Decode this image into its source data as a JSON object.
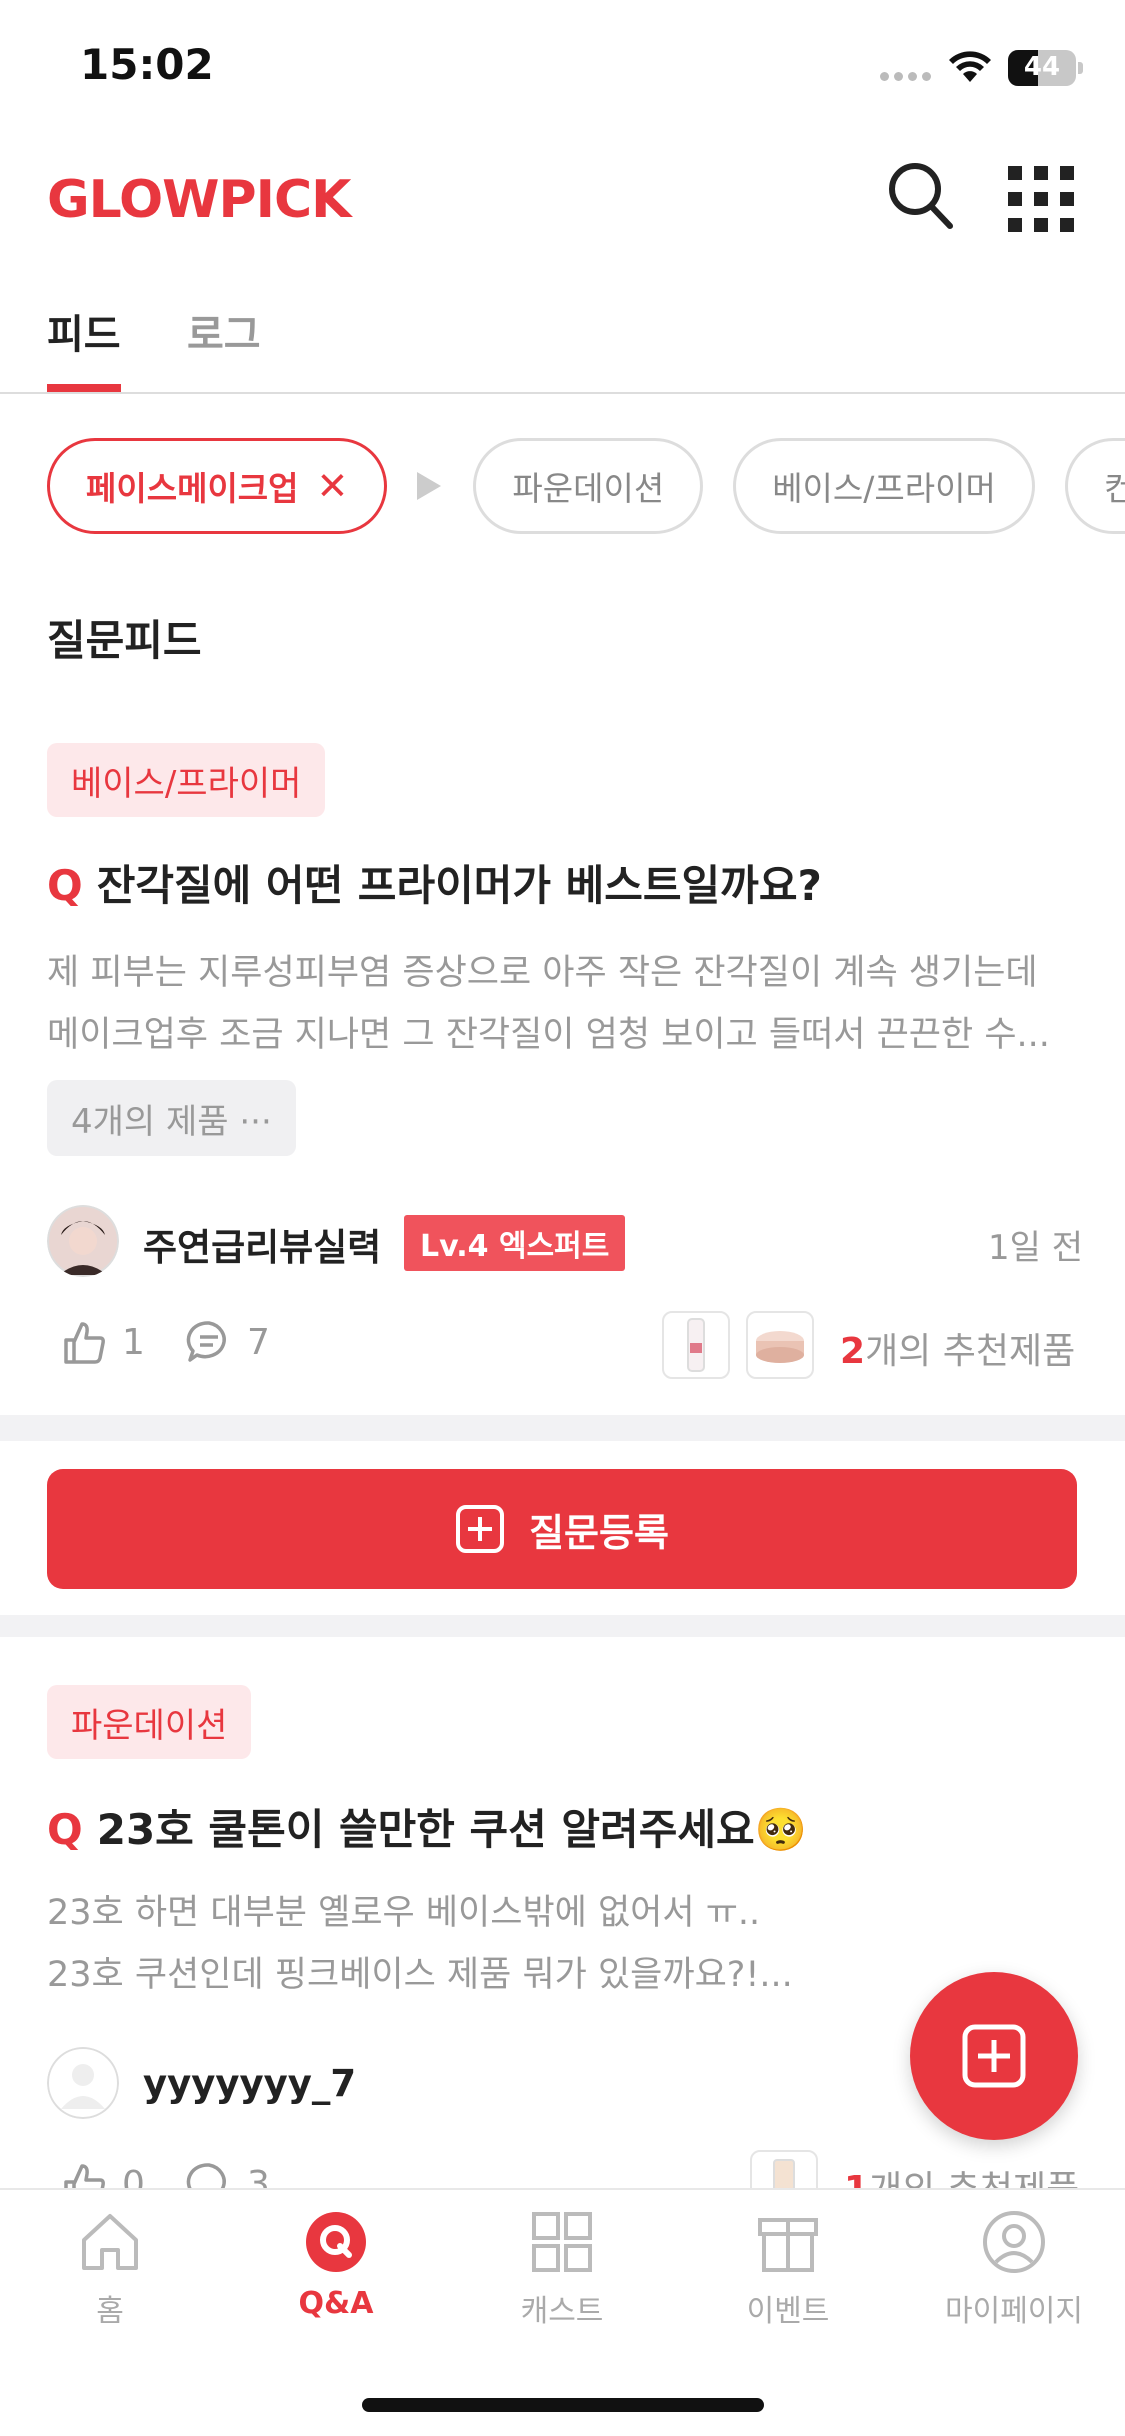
{
  "status_bar": {
    "time": "15:02",
    "battery": "44"
  },
  "header": {
    "logo": "GLOWPICK",
    "search_icon": "search-icon",
    "menu_icon": "grid-menu-icon"
  },
  "tabs": [
    {
      "label": "피드",
      "active": true
    },
    {
      "label": "로그",
      "active": false
    }
  ],
  "filter_chips": {
    "active": {
      "label": "페이스메이크업",
      "clear": "✕"
    },
    "items": [
      "파운데이션",
      "베이스/프라이머",
      "컨"
    ]
  },
  "feed": {
    "section_title": "질문피드",
    "posts": [
      {
        "category": "베이스/프라이머",
        "q_mark": "Q",
        "title": "잔각질에 어떤 프라이머가 베스트일까요?",
        "body_lines": [
          "제 피부는 지루성피부염 증상으로 아주 작은 잔각질이 계속 생기는데",
          "메이크업후 조금 지나면 그 잔각질이 엄청 보이고 들떠서 끈끈한 수..."
        ],
        "products_chip": "4개의 제품 ···",
        "user": {
          "name": "주연급리뷰실력",
          "level": "Lv.4 엑스퍼트"
        },
        "time": "1일 전",
        "likes": "1",
        "comments": "7",
        "recommend_count": "2",
        "recommend_suffix": "개의 추천제품"
      },
      {
        "category": "파운데이션",
        "q_mark": "Q",
        "title": "23호 쿨톤이 쓸만한 쿠션 알려주세요🥺",
        "body_lines": [
          "23호 하면 대부분 옐로우 베이스밖에 없어서 ㅠ..",
          "23호 쿠션인데 핑크베이스 제품 뭐가 있을까요?!..."
        ],
        "user": {
          "name": "yyyyyyy_7"
        },
        "likes": "0",
        "comments": "3",
        "recommend_count": "1",
        "recommend_suffix": "개의 추천제품"
      }
    ]
  },
  "cta": {
    "label": "질문등록",
    "icon": "plus-square-icon"
  },
  "fab": {
    "icon": "plus-square-icon"
  },
  "bottom_nav": [
    {
      "label": "홈",
      "icon": "home-icon",
      "active": false
    },
    {
      "label": "Q&A",
      "icon": "qa-icon",
      "active": true
    },
    {
      "label": "캐스트",
      "icon": "grid-icon",
      "active": false
    },
    {
      "label": "이벤트",
      "icon": "gift-box-icon",
      "active": false
    },
    {
      "label": "마이페이지",
      "icon": "user-icon",
      "active": false
    }
  ],
  "colors": {
    "brand": "#e8373f",
    "tag_bg": "#fde8ea",
    "muted": "#999999"
  }
}
